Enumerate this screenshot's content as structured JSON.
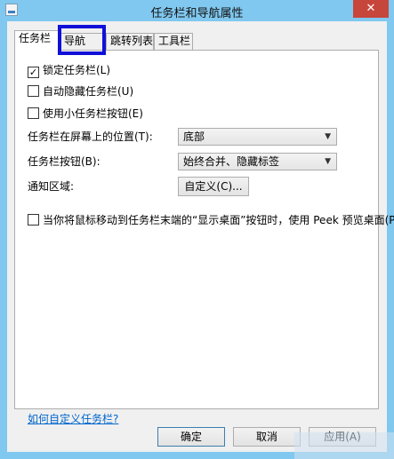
{
  "window": {
    "title": "任务栏和导航属性",
    "close_glyph": "✕"
  },
  "tabs": [
    {
      "label": "任务栏",
      "active": true
    },
    {
      "label": "导航",
      "active": false
    },
    {
      "label": "跳转列表",
      "active": false
    },
    {
      "label": "工具栏",
      "active": false
    }
  ],
  "taskbar": {
    "lock_taskbar": {
      "label": "锁定任务栏(L)",
      "checked": true
    },
    "auto_hide": {
      "label": "自动隐藏任务栏(U)",
      "checked": false
    },
    "small_buttons": {
      "label": "使用小任务栏按钮(E)",
      "checked": false
    },
    "location": {
      "label": "任务栏在屏幕上的位置(T):",
      "value": "底部"
    },
    "buttons": {
      "label": "任务栏按钮(B):",
      "value": "始终合并、隐藏标签"
    },
    "notification_area": {
      "label": "通知区域:",
      "button": "自定义(C)..."
    },
    "peek": {
      "label": "当你将鼠标移动到任务栏末端的“显示桌面”按钮时，使用 Peek 预览桌面(P)",
      "checked": false
    },
    "help_link": "如何自定义任务栏?"
  },
  "footer": {
    "ok": "确定",
    "cancel": "取消",
    "apply": "应用(A)"
  },
  "colors": {
    "titlebar": "#80c8ef",
    "close": "#c7463c",
    "highlight": "#1010d8",
    "link": "#0066cc"
  }
}
